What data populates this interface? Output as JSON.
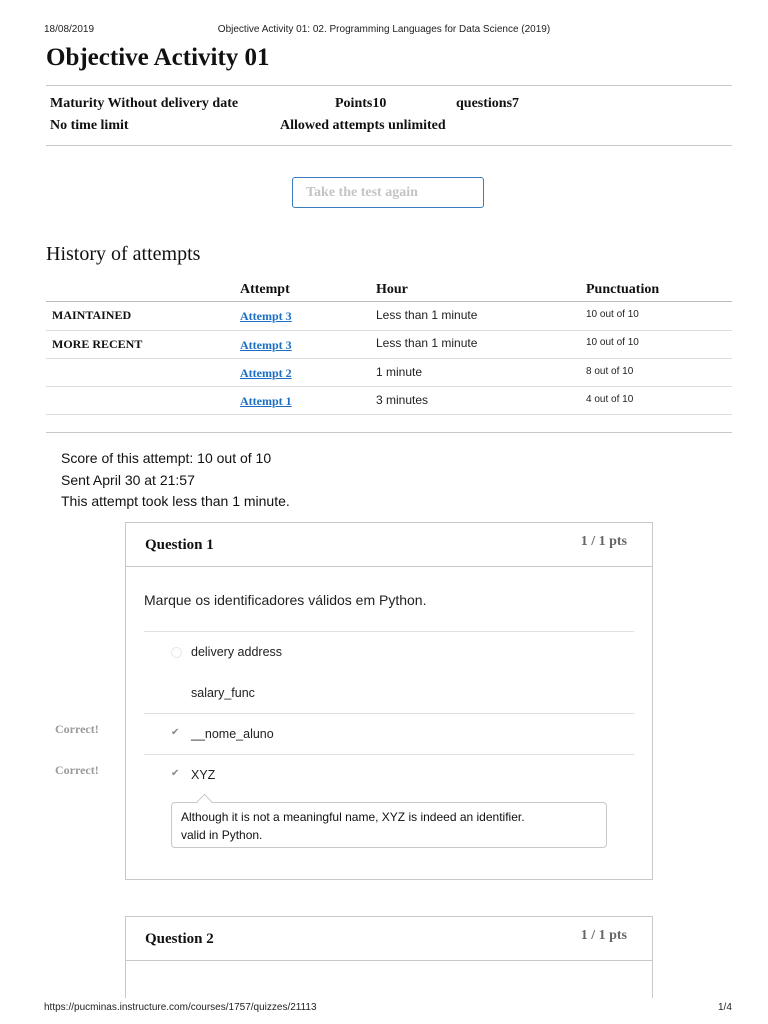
{
  "print_header": {
    "date": "18/08/2019",
    "title": "Objective Activity 01: 02. Programming Languages for Data Science (2019)"
  },
  "page_title": "Objective Activity 01",
  "meta": {
    "maturity": "Maturity Without delivery date",
    "points": "Points10",
    "questions": "questions7",
    "time_limit": "No time limit",
    "attempts": "Allowed attempts unlimited"
  },
  "retake_button": "Take the test again",
  "history": {
    "title": "History of attempts",
    "columns": [
      "Attempt",
      "Hour",
      "Punctuation"
    ],
    "rows": [
      {
        "label": "MAINTAINED",
        "attempt": "Attempt 3",
        "hour": "Less than 1 minute",
        "score": "10 out of 10"
      },
      {
        "label": "MORE RECENT",
        "attempt": "Attempt 3",
        "hour": "Less than 1 minute",
        "score": "10 out of 10"
      },
      {
        "label": "",
        "attempt": "Attempt 2",
        "hour": "1 minute",
        "score": "8 out of 10"
      },
      {
        "label": "",
        "attempt": "Attempt 1",
        "hour": "3 minutes",
        "score": "4 out of 10"
      }
    ]
  },
  "attempt_info": {
    "score": "Score of this attempt: 10 out of 10",
    "sent": "Sent April 30 at 21:57",
    "duration": "This attempt took less than 1 minute."
  },
  "questions": [
    {
      "title": "Question 1",
      "points": "1 / 1 pts",
      "text": "Marque os identificadores válidos em Python.",
      "answers": [
        {
          "text": "delivery address",
          "label": ""
        },
        {
          "text": "salary_func",
          "label": ""
        },
        {
          "text": "__nome_aluno",
          "label": "Correct!"
        },
        {
          "text": "XYZ",
          "label": "Correct!"
        }
      ],
      "comment_line1": "Although it is not a meaningful name, XYZ is indeed an identifier.",
      "comment_line2": "valid in Python."
    },
    {
      "title": "Question 2",
      "points": "1 / 1 pts"
    }
  ],
  "print_footer": {
    "url": "https://pucminas.instructure.com/courses/1757/quizzes/21113",
    "page": "1/4"
  },
  "colors": {
    "link": "#1a6fc4",
    "button_border": "#3a7dbf",
    "muted": "#9a9a9a"
  }
}
